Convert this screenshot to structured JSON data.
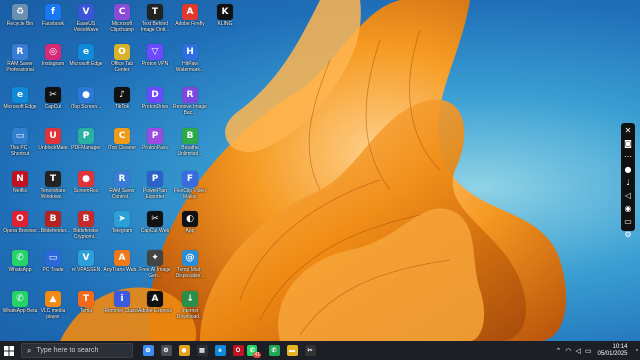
{
  "colors": {
    "taskbar": "#1c1f26",
    "wallpaper_orange": "#f08a12",
    "wallpaper_blue": "#2a86c8"
  },
  "desktop_icons": [
    {
      "label": "Recycle Bin",
      "icon": "recycle-bin-icon",
      "color": "#6b8fb0",
      "char": "♻"
    },
    {
      "label": "Facebook",
      "icon": "facebook-icon",
      "color": "#1877f2",
      "char": "f"
    },
    {
      "label": "EaseUS VoiceWave",
      "icon": "voicewave-icon",
      "color": "#3a55d8",
      "char": "V"
    },
    {
      "label": "Microsoft Clipchamp",
      "icon": "clipchamp-icon",
      "color": "#8a4bd6",
      "char": "C"
    },
    {
      "label": "Text Behind Image Onli...",
      "icon": "text-behind-image-icon",
      "color": "#222222",
      "char": "T"
    },
    {
      "label": "Adobe Firefly",
      "icon": "adobe-firefly-icon",
      "color": "#e13a2d",
      "char": "A"
    },
    {
      "label": "KLING",
      "icon": "kling-icon",
      "color": "#111111",
      "char": "K"
    },
    {
      "label": "RAM Saver Professional",
      "icon": "ram-saver-icon",
      "color": "#3a7bd5",
      "char": "R"
    },
    {
      "label": "Instagram",
      "icon": "instagram-icon",
      "color": "#d62976",
      "char": "◎"
    },
    {
      "label": "Microsoft Edge",
      "icon": "edge-icon",
      "color": "#0f8ad8",
      "char": "e"
    },
    {
      "label": "Office Tab Center",
      "icon": "office-tab-icon",
      "color": "#d8b22a",
      "char": "O"
    },
    {
      "label": "Proton VPN",
      "icon": "proton-vpn-icon",
      "color": "#6d4aff",
      "char": "▽"
    },
    {
      "label": "HitPaw Watermark...",
      "icon": "hitpaw-icon",
      "color": "#2d6ee0",
      "char": "H"
    },
    {
      "label": "Microsoft Edge",
      "icon": "edge-icon",
      "color": "#0f8ad8",
      "char": "e"
    },
    {
      "label": "CapCut",
      "icon": "capcut-icon",
      "color": "#111111",
      "char": "✂"
    },
    {
      "label": "iTop Screen...",
      "icon": "itop-screen-icon",
      "color": "#2a78d8",
      "char": "●"
    },
    {
      "label": "TikTok",
      "icon": "tiktok-icon",
      "color": "#111111",
      "char": "♪"
    },
    {
      "label": "ProtonDrive",
      "icon": "proton-drive-icon",
      "color": "#6d4aff",
      "char": "D"
    },
    {
      "label": "Remove Image Bac...",
      "icon": "remove-bg-icon",
      "color": "#7b4be0",
      "char": "R"
    },
    {
      "label": "This PC - Shortcut",
      "icon": "this-pc-icon",
      "color": "#2f7fd0",
      "char": "▭"
    },
    {
      "label": "UnblockMate",
      "icon": "unblockmate-icon",
      "color": "#e0343a",
      "char": "U"
    },
    {
      "label": "PDFManager",
      "icon": "pdf-manager-icon",
      "color": "#2ab0a0",
      "char": "P"
    },
    {
      "label": "iTop Cleaner",
      "icon": "itop-cleaner-icon",
      "color": "#f09a1a",
      "char": "C"
    },
    {
      "label": "ProtonPass",
      "icon": "proton-pass-icon",
      "color": "#9b4be0",
      "char": "P"
    },
    {
      "label": "Breathe Unlimited...",
      "icon": "breathe-icon",
      "color": "#2fa84a",
      "char": "B"
    },
    {
      "label": "Netflix",
      "icon": "netflix-icon",
      "color": "#c1121f",
      "char": "N"
    },
    {
      "label": "Tenorshare Windows...",
      "icon": "tenorshare-icon",
      "color": "#222222",
      "char": "T"
    },
    {
      "label": "ScreenRec",
      "icon": "screenrec-icon",
      "color": "#e0343a",
      "char": "●"
    },
    {
      "label": "RAM Saver Control...",
      "icon": "ram-saver-control-icon",
      "color": "#3a7bd5",
      "char": "R"
    },
    {
      "label": "PowerPlan Exporter",
      "icon": "powerplan-icon",
      "color": "#2a62c8",
      "char": "P"
    },
    {
      "label": "FlexClip Video Maker",
      "icon": "flexclip-icon",
      "color": "#3a6ae0",
      "char": "F"
    },
    {
      "label": "Opera Browser",
      "icon": "opera-icon",
      "color": "#e0202e",
      "char": "O"
    },
    {
      "label": "…Bitdefender...",
      "icon": "bitdefender-icon",
      "color": "#b52222",
      "char": "B"
    },
    {
      "label": "Bitdefender Cryptomi...",
      "icon": "bitdefender-crypto-icon",
      "color": "#c62b2b",
      "char": "B"
    },
    {
      "label": "Telegram",
      "icon": "telegram-icon",
      "color": "#2a9fd8",
      "char": "➤"
    },
    {
      "label": "CapCut Web",
      "icon": "capcut-web-icon",
      "color": "#111111",
      "char": "✂"
    },
    {
      "label": "App",
      "icon": "app-icon",
      "color": "#111111",
      "char": "◐"
    },
    {
      "label": "WhatsApp",
      "icon": "whatsapp-icon",
      "color": "#25d366",
      "char": "✆"
    },
    {
      "label": "PC Trade",
      "icon": "pc-trade-icon",
      "color": "#2a6ad8",
      "char": "▭"
    },
    {
      "label": "nl VPASSEN",
      "icon": "vpassen-icon",
      "color": "#2a9fd8",
      "char": "V"
    },
    {
      "label": "AnyTrans Web...",
      "icon": "anytrans-icon",
      "color": "#f07a1a",
      "char": "A"
    },
    {
      "label": "Free AI Image Gen...",
      "icon": "ai-image-gen-icon",
      "color": "#444444",
      "char": "✦"
    },
    {
      "label": "Temp Mail - Disposable...",
      "icon": "temp-mail-icon",
      "color": "#2a8fd8",
      "char": "@"
    },
    {
      "label": "WhatsApp Beta",
      "icon": "whatsapp-beta-icon",
      "color": "#25d366",
      "char": "✆"
    },
    {
      "label": "VLC media player",
      "icon": "vlc-icon",
      "color": "#f08a12",
      "char": "▲"
    },
    {
      "label": "Temu",
      "icon": "temu-icon",
      "color": "#f26a1b",
      "char": "T"
    },
    {
      "label": "iRemove Classic",
      "icon": "iremove-icon",
      "color": "#3a5ae0",
      "char": "i"
    },
    {
      "label": "Adobe Express",
      "icon": "adobe-express-icon",
      "color": "#111111",
      "char": "A"
    },
    {
      "label": "Internet Download...",
      "icon": "idm-icon",
      "color": "#2a8f4a",
      "char": "↓"
    }
  ],
  "side_toolbar": [
    {
      "icon": "close-icon",
      "char": "✕"
    },
    {
      "icon": "camera-icon",
      "char": "◙"
    },
    {
      "icon": "more-icon",
      "char": "⋯"
    },
    {
      "icon": "record-icon",
      "char": "●"
    },
    {
      "icon": "microphone-icon",
      "char": "♩"
    },
    {
      "icon": "speaker-icon",
      "char": "◁"
    },
    {
      "icon": "webcam-icon",
      "char": "◉"
    },
    {
      "icon": "comment-icon",
      "char": "▭"
    },
    {
      "icon": "settings-icon",
      "char": "⚙"
    }
  ],
  "taskbar": {
    "search_placeholder": "Type here to search",
    "apps": [
      {
        "icon": "copilot-icon",
        "char": "✿",
        "color": "#3b8cf0"
      },
      {
        "icon": "settings-icon",
        "char": "⚙",
        "color": "#4a4f58"
      },
      {
        "icon": "chrome-icon",
        "char": "◉",
        "color": "#e2a21a"
      },
      {
        "icon": "task-view-icon",
        "char": "▤",
        "color": "#2b2f38"
      },
      {
        "icon": "edge-icon",
        "char": "e",
        "color": "#0f8ad8"
      },
      {
        "icon": "opera-icon",
        "char": "O",
        "color": "#c1121f"
      },
      {
        "icon": "whatsapp-icon",
        "char": "✆",
        "color": "#25d366"
      },
      {
        "icon": "whatsapp-beta-icon",
        "char": "✆",
        "color": "#1fa855"
      },
      {
        "icon": "file-explorer-icon",
        "char": "▬",
        "color": "#e6b422"
      },
      {
        "icon": "capcut-icon",
        "char": "✂",
        "color": "#333333"
      }
    ],
    "whatsapp_badge": "41",
    "time": "10:14",
    "date": "05/01/2025"
  }
}
